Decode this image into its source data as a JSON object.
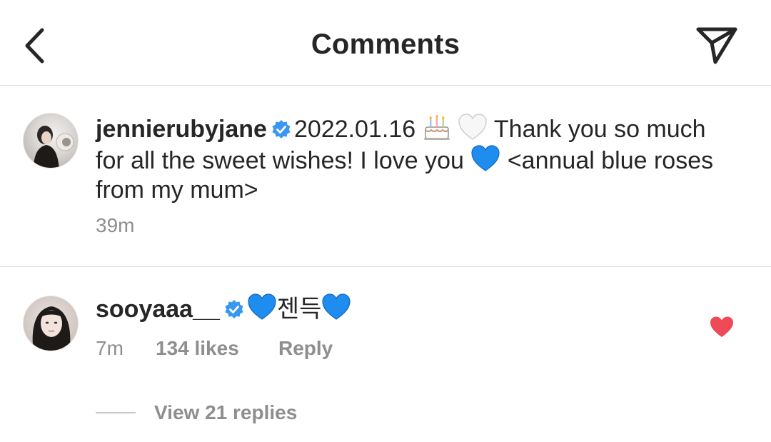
{
  "header": {
    "title": "Comments",
    "back_icon": "chevron-left-icon",
    "share_icon": "paper-plane-icon"
  },
  "caption": {
    "username": "jennierubyjane",
    "date": "2022.01.16",
    "text_part1": "Thank you so much for all the sweet wishes! I love you",
    "text_part2": "<annual blue roses from my mum>",
    "emojis": [
      "birthday-cake",
      "white-heart",
      "blue-heart"
    ],
    "time": "39m"
  },
  "comment": {
    "username": "sooyaaa__",
    "text": "젠득",
    "emojis": [
      "blue-heart",
      "blue-heart"
    ],
    "time": "7m",
    "likes": "134 likes",
    "reply_label": "Reply",
    "liked": true,
    "replies_label": "View 21 replies"
  },
  "colors": {
    "verified": "#3897f0",
    "blue_heart": "#1f8cf0",
    "like_red": "#ed4956",
    "meta_gray": "#8e8e8e",
    "text": "#262626"
  }
}
